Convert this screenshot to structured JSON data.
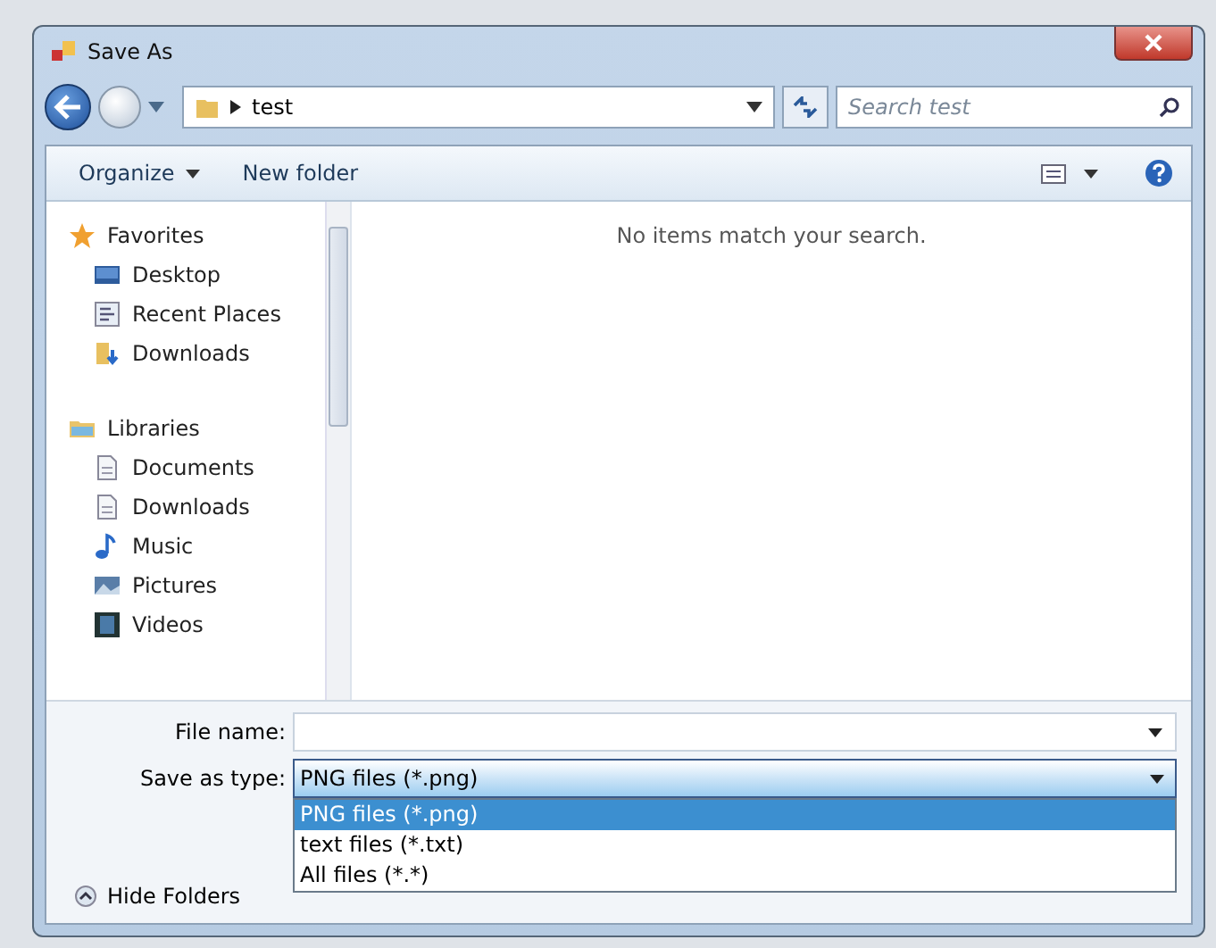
{
  "window": {
    "title": "Save As"
  },
  "address": {
    "path": "test"
  },
  "search": {
    "placeholder": "Search test"
  },
  "toolbar": {
    "buttons": [
      {
        "label": "Organize",
        "dropdown": true
      },
      {
        "label": "New folder",
        "dropdown": false
      }
    ]
  },
  "nav": {
    "groups": [
      {
        "label": "Favorites",
        "kind": "star",
        "children": [
          {
            "label": "Desktop",
            "kind": "desktop"
          },
          {
            "label": "Recent Places",
            "kind": "recent"
          },
          {
            "label": "Downloads",
            "kind": "download"
          }
        ]
      },
      {
        "label": "Libraries",
        "kind": "library",
        "children": [
          {
            "label": "Documents",
            "kind": "document"
          },
          {
            "label": "Downloads",
            "kind": "document"
          },
          {
            "label": "Music",
            "kind": "music"
          },
          {
            "label": "Pictures",
            "kind": "pictures"
          },
          {
            "label": "Videos",
            "kind": "videos"
          }
        ]
      }
    ]
  },
  "content": {
    "message": "No items match your search."
  },
  "form": {
    "file_name": {
      "label": "File name:"
    },
    "save_as_type": {
      "label": "Save as type:",
      "value": "PNG files (*.png)",
      "expanded": true,
      "options": [
        {
          "label": "PNG files (*.png)",
          "selected": true
        },
        {
          "label": "text files (*.txt)",
          "selected": false
        },
        {
          "label": "All files (*.*)",
          "selected": false
        }
      ]
    }
  },
  "hide_folders": {
    "label": "Hide Folders"
  }
}
